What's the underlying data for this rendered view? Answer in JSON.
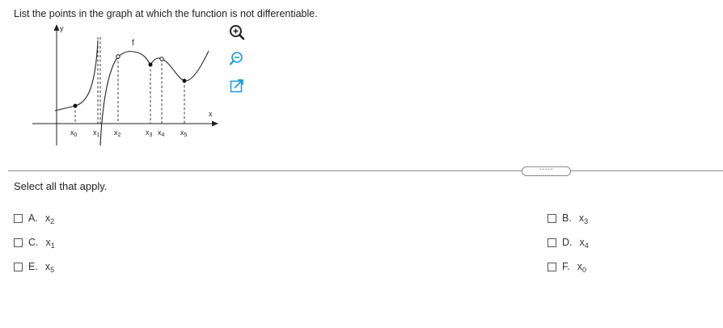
{
  "question": {
    "text": "List the points in the graph at which the function is not differentiable."
  },
  "graph": {
    "x_axis_label": "x",
    "y_axis_label": "y",
    "function_label": "f",
    "tick_labels": [
      {
        "base": "x",
        "sub": "0"
      },
      {
        "base": "x",
        "sub": "1"
      },
      {
        "base": "x",
        "sub": "2"
      },
      {
        "base": "x",
        "sub": "3"
      },
      {
        "base": "x",
        "sub": "4"
      },
      {
        "base": "x",
        "sub": "5"
      }
    ]
  },
  "tools": {
    "zoom_in_icon": "zoom-in-icon",
    "zoom_out_icon": "zoom-out-icon",
    "popout_icon": "popout-icon"
  },
  "expander": {
    "label": "....."
  },
  "instruction": "Select all that apply.",
  "options": [
    {
      "letter": "A.",
      "base": "x",
      "sub": "2"
    },
    {
      "letter": "B.",
      "base": "x",
      "sub": "3"
    },
    {
      "letter": "C.",
      "base": "x",
      "sub": "1"
    },
    {
      "letter": "D.",
      "base": "x",
      "sub": "4"
    },
    {
      "letter": "E.",
      "base": "x",
      "sub": "5"
    },
    {
      "letter": "F.",
      "base": "x",
      "sub": "0"
    }
  ],
  "colors": {
    "accent": "#1a9ad6",
    "icon_dark": "#333333"
  }
}
